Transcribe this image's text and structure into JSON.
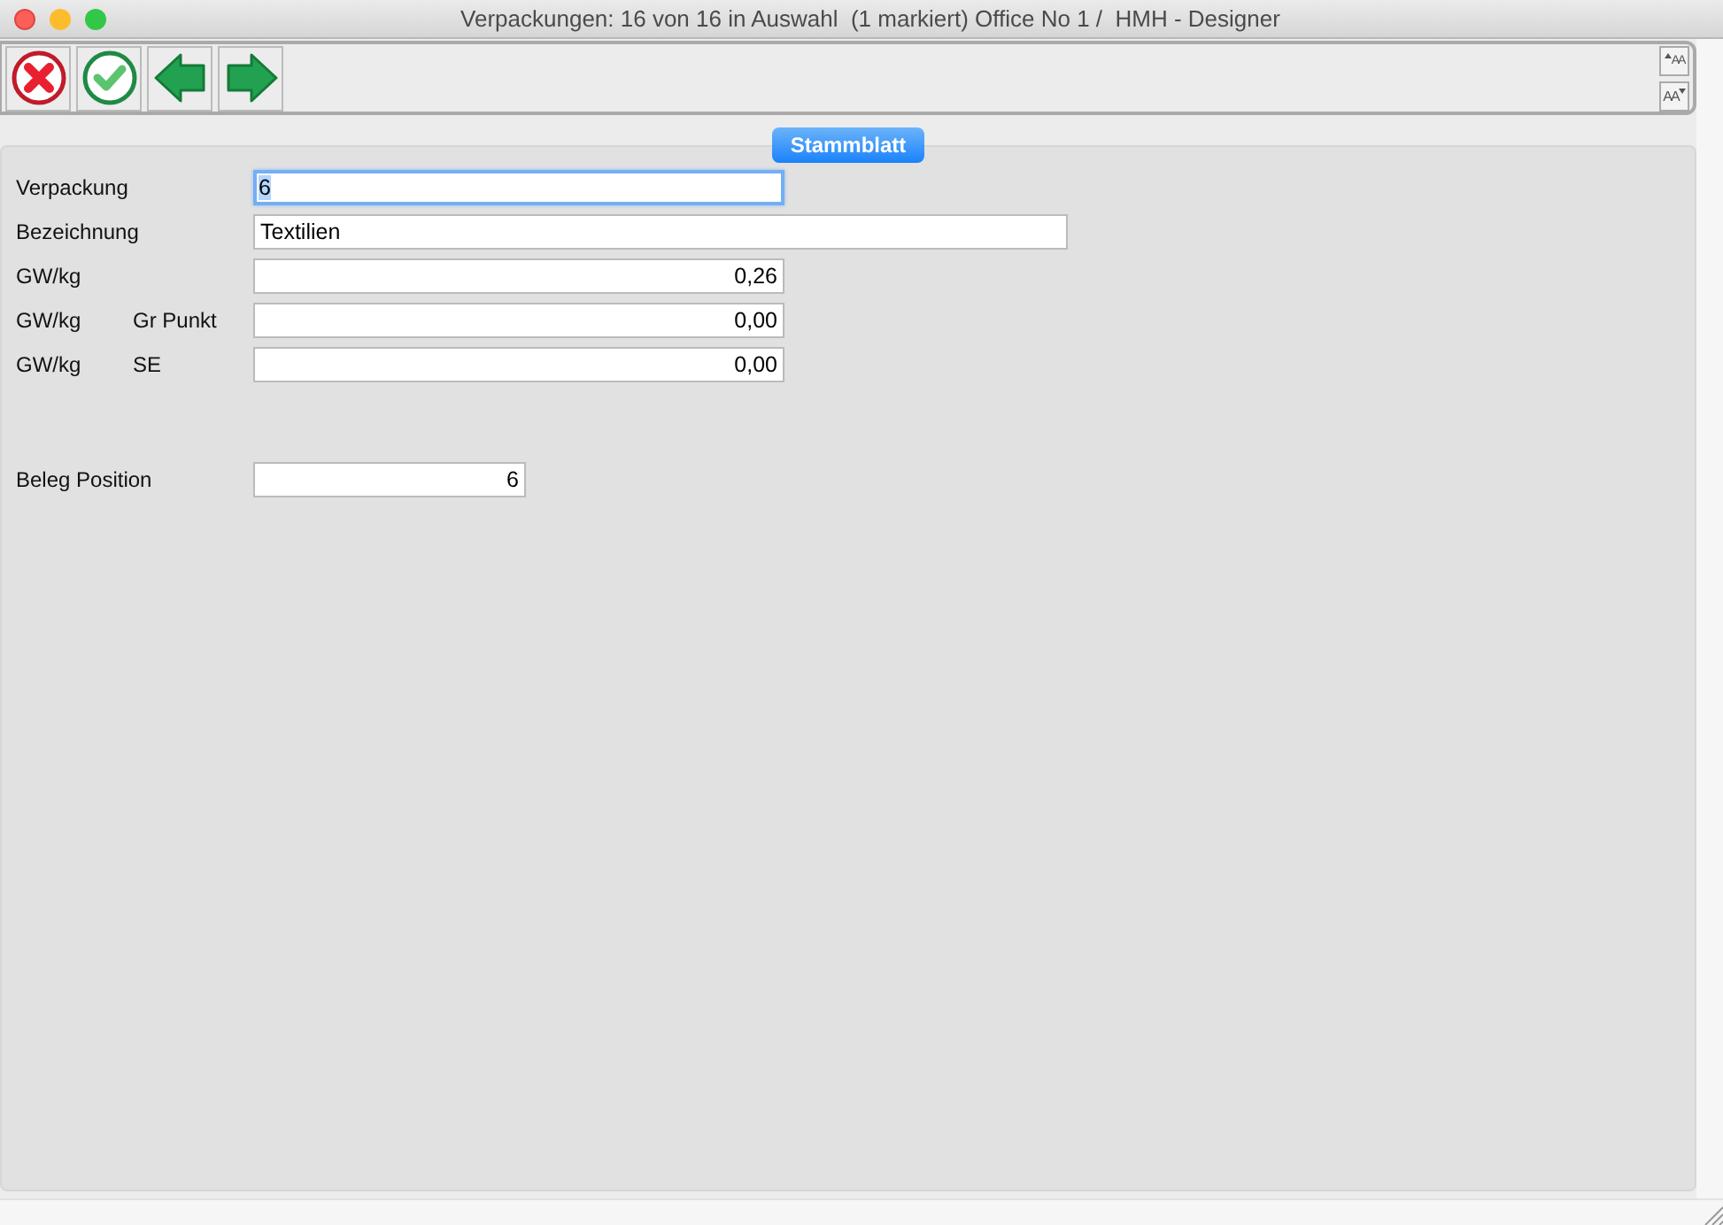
{
  "window": {
    "title": "Verpackungen: 16 von 16 in Auswahl  (1 markiert) Office No 1 /  HMH - Designer"
  },
  "toolbar": {
    "buttons": [
      {
        "kind": "cancel"
      },
      {
        "kind": "ok"
      },
      {
        "kind": "previous"
      },
      {
        "kind": "next"
      }
    ],
    "font_buttons": [
      {
        "kind": "increase",
        "label": "AA"
      },
      {
        "kind": "decrease",
        "label": "AA"
      }
    ]
  },
  "tab": {
    "label": "Stammblatt",
    "selected": true
  },
  "groups": [
    [
      {
        "label": "Verpackung",
        "value": "6",
        "kind": "text",
        "focused": true
      },
      {
        "label": "Bezeichnung",
        "value": "Textilien",
        "kind": "text",
        "focused": false
      },
      {
        "label": "GW/kg",
        "value": "0,26",
        "kind": "number",
        "focused": false
      },
      {
        "label": "GW/kg",
        "sublabel": "Gr Punkt",
        "value": "0,00",
        "kind": "number",
        "focused": false
      },
      {
        "label": "GW/kg",
        "sublabel": "SE",
        "value": "0,00",
        "kind": "number",
        "focused": false
      }
    ],
    [
      {
        "label": "Beleg Position",
        "value": "6",
        "kind": "number",
        "focused": false
      }
    ]
  ]
}
